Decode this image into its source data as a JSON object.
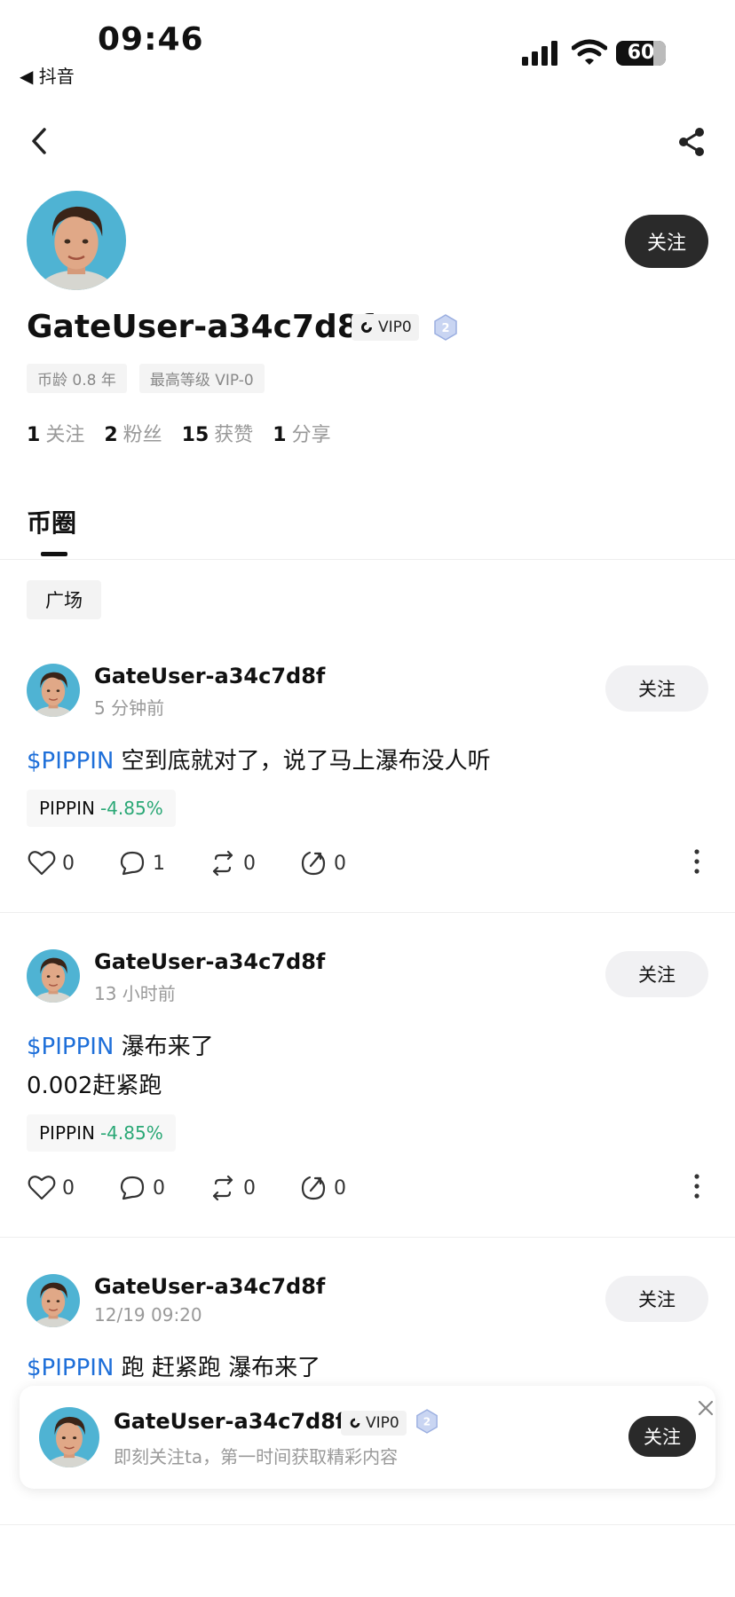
{
  "status_bar": {
    "time": "09:46",
    "back_app": "◀ 抖音",
    "battery": "60"
  },
  "profile": {
    "username": "GateUser-a34c7d8f",
    "vip": "VIP0",
    "level": "2",
    "follow_label": "关注",
    "tags": [
      "币龄 0.8 年",
      "最高等级 VIP-0"
    ],
    "stats": [
      {
        "value": "1",
        "label": "关注"
      },
      {
        "value": "2",
        "label": "粉丝"
      },
      {
        "value": "15",
        "label": "获赞"
      },
      {
        "value": "1",
        "label": "分享"
      }
    ]
  },
  "tabs": {
    "active": "币圈",
    "filter_chip": "广场"
  },
  "posts": [
    {
      "name": "GateUser-a34c7d8f",
      "time": "5 分钟前",
      "follow_label": "关注",
      "ticker": "$PIPPIN",
      "text_line1": " 空到底就对了，说了马上瀑布没人听",
      "text_line2": "",
      "pill_symbol": "PIPPIN",
      "pill_change": "-4.85%",
      "likes": "0",
      "comments": "1",
      "reposts": "0",
      "shares": "0"
    },
    {
      "name": "GateUser-a34c7d8f",
      "time": "13 小时前",
      "follow_label": "关注",
      "ticker": "$PIPPIN",
      "text_line1": " 瀑布来了",
      "text_line2": "0.002赶紧跑",
      "pill_symbol": "PIPPIN",
      "pill_change": "-4.85%",
      "likes": "0",
      "comments": "0",
      "reposts": "0",
      "shares": "0"
    },
    {
      "name": "GateUser-a34c7d8f",
      "time": "12/19 09:20",
      "follow_label": "关注",
      "ticker": "$PIPPIN",
      "text_line1": " 跑  赶紧跑  瀑布来了"
    }
  ],
  "popup": {
    "name": "GateUser-a34c7d8f",
    "vip": "VIP0",
    "level": "2",
    "subtitle": "即刻关注ta，第一时间获取精彩内容",
    "follow_label": "关注"
  },
  "colors": {
    "accent_blue": "#1e6fd9",
    "change_green": "#2aa876",
    "dark_button": "#2a2a2a"
  }
}
